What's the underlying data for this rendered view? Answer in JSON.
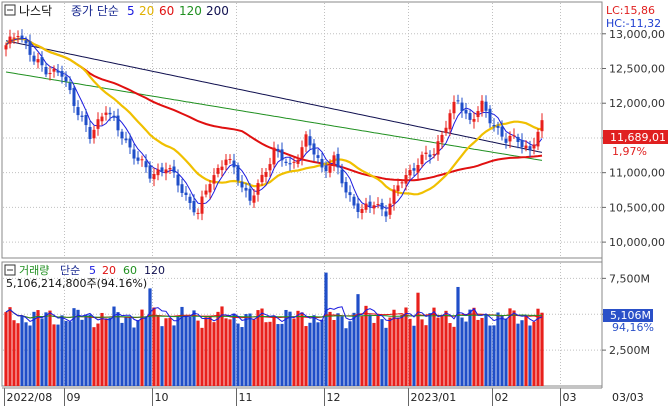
{
  "header": {
    "instrument": "나스닥",
    "indicator_label": "종가 단순",
    "ma_periods": [
      "5",
      "20",
      "60",
      "120",
      "200"
    ],
    "lc_text": "LC:15,86",
    "hc_text": "HC:-11,32"
  },
  "volume_header": {
    "label": "거래량",
    "indicator_label": "단순",
    "ma_periods": [
      "5",
      "20",
      "60",
      "120"
    ],
    "value_text": "5,106,214,800주(94.16%)"
  },
  "price_axis": {
    "ticks": [
      "13,000,00",
      "12,500,00",
      "12,000,00",
      "11,500,00",
      "11,000,00",
      "10,500,00",
      "10,000,00"
    ],
    "last_value_label": "11,689,01",
    "change_label": "1,97%"
  },
  "volume_axis": {
    "ticks": [
      "7,500M",
      "5,000M",
      "2,500M"
    ],
    "last_value_label": "5,106M",
    "pct_label": "94,16%"
  },
  "date_axis": {
    "labels": [
      "2022/08",
      "09",
      "10",
      "11",
      "12",
      "2023/01",
      "02",
      "03",
      "03/03"
    ]
  },
  "colors": {
    "up": "#e8201c",
    "down": "#1f4ec8",
    "ma5": "#1b1be0",
    "ma20": "#f0c000",
    "ma60": "#e01010",
    "ma120": "#209020",
    "ma200": "#101050",
    "header_text": "#1a2a90",
    "grid": "#c0c0c0"
  },
  "chart_data": {
    "type": "candlestick",
    "title": "나스닥",
    "x_start": "2022-08",
    "x_end": "2023-03-03",
    "price_range": [
      9800,
      13400
    ],
    "volume_range": [
      0,
      8500
    ],
    "volume_unit": "M",
    "last_close": 11689.01,
    "last_change_pct": 1.97,
    "last_volume": 5106.2148,
    "last_volume_pct": 94.16,
    "monthly_closes": [
      {
        "month": "2022/08",
        "close": 11816
      },
      {
        "month": "09",
        "close": 10576
      },
      {
        "month": "10",
        "close": 10988
      },
      {
        "month": "11",
        "close": 11468
      },
      {
        "month": "12",
        "close": 10466
      },
      {
        "month": "2023/01",
        "close": 11584
      },
      {
        "month": "02",
        "close": 11456
      }
    ],
    "moving_averages": [
      "5",
      "20",
      "60",
      "120",
      "200"
    ],
    "volume_moving_averages": [
      "5",
      "20",
      "60",
      "120"
    ],
    "grid": true
  }
}
